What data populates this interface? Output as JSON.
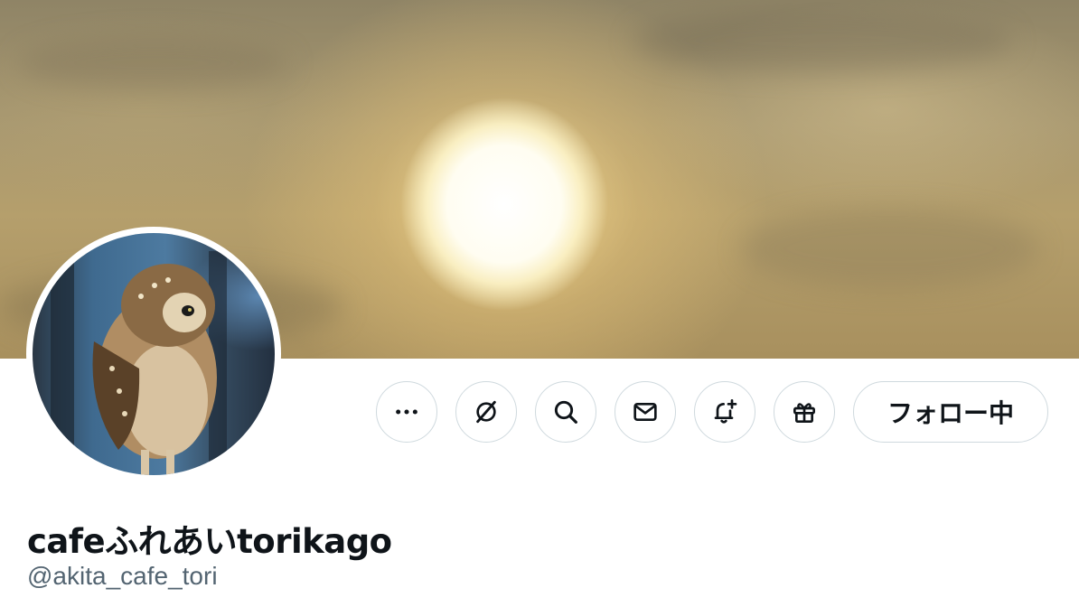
{
  "profile": {
    "display_name": "cafeふれあいtorikago",
    "handle": "@akita_cafe_tori",
    "banner_image": "sunset-sun-behind-clouds",
    "avatar_image": "burrowing-owl-photo"
  },
  "actions": {
    "more_icon": "more-icon",
    "grok_icon": "grok-icon",
    "search_icon": "search-icon",
    "message_icon": "mail-icon",
    "notify_icon": "bell-plus-icon",
    "gift_icon": "gift-icon",
    "follow_label": "フォロー中"
  },
  "colors": {
    "text_primary": "#0f1419",
    "text_secondary": "#536471",
    "border": "#cfd9de"
  }
}
